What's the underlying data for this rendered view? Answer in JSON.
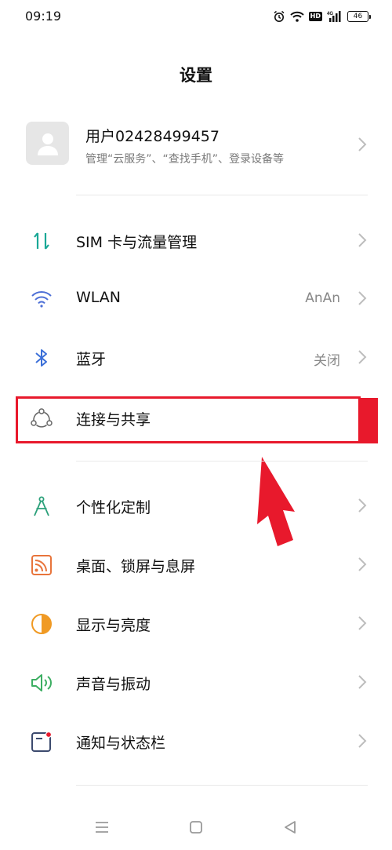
{
  "status": {
    "time": "09:19",
    "hd": "HD",
    "network": "4G",
    "battery": "46"
  },
  "page": {
    "title": "设置"
  },
  "account": {
    "name": "用户02428499457",
    "subtitle": "管理“云服务”、“查找手机”、登录设备等"
  },
  "settings": {
    "sim": {
      "label": "SIM 卡与流量管理",
      "icon": "sim-data-icon"
    },
    "wlan": {
      "label": "WLAN",
      "value": "AnAn",
      "icon": "wifi-icon"
    },
    "bluetooth": {
      "label": "蓝牙",
      "value": "关闭",
      "icon": "bluetooth-icon"
    },
    "connection": {
      "label": "连接与共享",
      "icon": "connection-sharing-icon"
    },
    "personalize": {
      "label": "个性化定制",
      "icon": "compass-icon"
    },
    "desktop": {
      "label": "桌面、锁屏与息屏",
      "icon": "wallpaper-icon"
    },
    "display": {
      "label": "显示与亮度",
      "icon": "brightness-icon"
    },
    "sound": {
      "label": "声音与振动",
      "icon": "speaker-icon"
    },
    "notification": {
      "label": "通知与状态栏",
      "icon": "notification-icon"
    }
  },
  "colors": {
    "highlight": "#e8192c",
    "sim": "#1aa896",
    "wlan": "#4d6fd6",
    "bluetooth": "#3b6fd8",
    "personalize": "#2ba07a",
    "desktop": "#e8743b",
    "display": "#f09a24",
    "sound": "#3cae62",
    "notification": "#3c4a6e"
  }
}
